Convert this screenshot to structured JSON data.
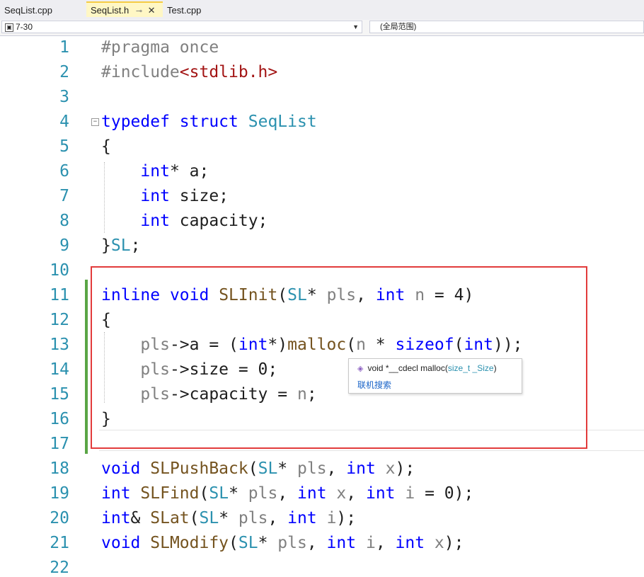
{
  "tabs": [
    {
      "label": "SeqList.cpp"
    },
    {
      "label": "SeqList.h",
      "active": true
    },
    {
      "label": "Test.cpp"
    }
  ],
  "tab_icons": {
    "pin": "pin-icon",
    "close": "close-icon"
  },
  "navbar": {
    "location": "7-30",
    "scope": "(全局范围)"
  },
  "lines": [
    {
      "num": "1"
    },
    {
      "num": "2"
    },
    {
      "num": "3"
    },
    {
      "num": "4"
    },
    {
      "num": "5"
    },
    {
      "num": "6"
    },
    {
      "num": "7"
    },
    {
      "num": "8"
    },
    {
      "num": "9"
    },
    {
      "num": "10"
    },
    {
      "num": "11"
    },
    {
      "num": "12"
    },
    {
      "num": "13"
    },
    {
      "num": "14"
    },
    {
      "num": "15"
    },
    {
      "num": "16"
    },
    {
      "num": "17"
    },
    {
      "num": "18"
    },
    {
      "num": "19"
    },
    {
      "num": "20"
    },
    {
      "num": "21"
    },
    {
      "num": "22"
    }
  ],
  "code": {
    "l1": "#pragma once",
    "l2a": "#include",
    "l2b": "<stdlib.h>",
    "l4a": "typedef",
    "l4b": "struct",
    "l4c": "SeqList",
    "l5": "{",
    "l6a": "int",
    "l6b": "* a;",
    "l7a": "int",
    "l7b": " size;",
    "l8a": "int",
    "l8b": " capacity;",
    "l9a": "}",
    "l9b": "SL",
    "l9c": ";",
    "l11a": "inline",
    "l11b": "void",
    "l11c": "SLInit",
    "l11d": "(",
    "l11e": "SL",
    "l11f": "* ",
    "l11g": "pls",
    "l11h": ", ",
    "l11i": "int",
    "l11j": "n",
    "l11k": " = 4)",
    "l12": "{",
    "l13a": "pls",
    "l13b": "->a = (",
    "l13c": "int",
    "l13d": "*)",
    "l13e": "malloc",
    "l13f": "(",
    "l13g": "n",
    "l13h": " * ",
    "l13i": "sizeof",
    "l13j": "(",
    "l13k": "int",
    "l13l": "));",
    "l14a": "pls",
    "l14b": "->size = 0;",
    "l15a": "pls",
    "l15b": "->capacity = ",
    "l15c": "n",
    "l15d": ";",
    "l16": "}",
    "l18a": "void",
    "l18b": "SLPushBack",
    "l18c": "(",
    "l18d": "SL",
    "l18e": "* ",
    "l18f": "pls",
    "l18g": ", ",
    "l18h": "int",
    "l18i": "x",
    "l18j": ");",
    "l19a": "int",
    "l19b": "SLFind",
    "l19c": "(",
    "l19d": "SL",
    "l19e": "* ",
    "l19f": "pls",
    "l19g": ", ",
    "l19h": "int",
    "l19i": "x",
    "l19j": ", ",
    "l19k": "int",
    "l19l": "i",
    "l19m": " = 0);",
    "l20a": "int",
    "l20b": "& ",
    "l20c": "SLat",
    "l20d": "(",
    "l20e": "SL",
    "l20f": "* ",
    "l20g": "pls",
    "l20h": ", ",
    "l20i": "int",
    "l20j": "i",
    "l20k": ");",
    "l21a": "void",
    "l21b": "SLModify",
    "l21c": "(",
    "l21d": "SL",
    "l21e": "* ",
    "l21f": "pls",
    "l21g": ", ",
    "l21h": "int",
    "l21i": "i",
    "l21j": ", ",
    "l21k": "int",
    "l21l": "x",
    "l21m": ");"
  },
  "tooltip": {
    "icon": "cube-icon",
    "sig_a": "void *__cdecl malloc(",
    "sig_b": "size_t _Size",
    "sig_c": ")",
    "link": "联机搜索"
  },
  "colors": {
    "keyword": "#0000ff",
    "type": "#2b91af",
    "preprocessor": "#808080",
    "string": "#a31515",
    "parameter": "#808080",
    "function": "#74531f",
    "line_number": "#2b91af",
    "change_bar": "#5aa545",
    "highlight_box": "#e23b3b"
  }
}
